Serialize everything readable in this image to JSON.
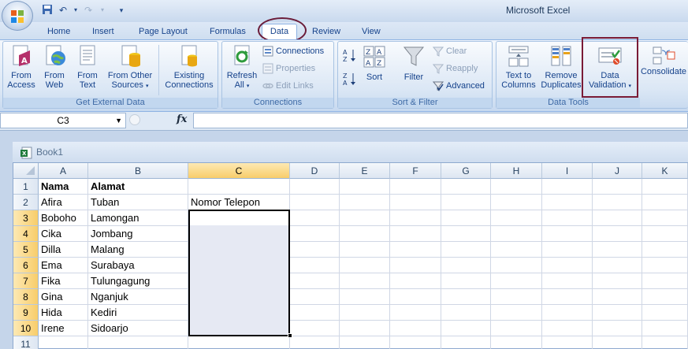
{
  "app": {
    "title": "Microsoft Excel"
  },
  "tabs": [
    {
      "label": "Home"
    },
    {
      "label": "Insert"
    },
    {
      "label": "Page Layout"
    },
    {
      "label": "Formulas"
    },
    {
      "label": "Data"
    },
    {
      "label": "Review"
    },
    {
      "label": "View"
    }
  ],
  "active_tab": "Data",
  "ribbon": {
    "get_external_data": {
      "label": "Get External Data",
      "buttons": [
        {
          "line1": "From",
          "line2": "Access",
          "icon": "access-db-icon"
        },
        {
          "line1": "From",
          "line2": "Web",
          "icon": "web-globe-icon"
        },
        {
          "line1": "From",
          "line2": "Text",
          "icon": "text-file-icon"
        },
        {
          "line1": "From Other",
          "line2": "Sources",
          "icon": "other-sources-icon"
        },
        {
          "line1": "Existing",
          "line2": "Connections",
          "icon": "existing-connections-icon"
        }
      ]
    },
    "connections": {
      "label": "Connections",
      "refresh_line1": "Refresh",
      "refresh_line2": "All",
      "connections": "Connections",
      "properties": "Properties",
      "edit_links": "Edit Links"
    },
    "sort_filter": {
      "label": "Sort & Filter",
      "sort": "Sort",
      "filter": "Filter",
      "clear": "Clear",
      "reapply": "Reapply",
      "advanced": "Advanced"
    },
    "data_tools": {
      "label": "Data Tools",
      "text_to_columns_line1": "Text to",
      "text_to_columns_line2": "Columns",
      "remove_duplicates_line1": "Remove",
      "remove_duplicates_line2": "Duplicates",
      "data_validation_line1": "Data",
      "data_validation_line2": "Validation",
      "consolidate": "Consolidate"
    }
  },
  "formula_bar": {
    "name_box": "C3",
    "fx": "fx",
    "value": ""
  },
  "workbook": {
    "title": "Book1"
  },
  "columns": [
    "A",
    "B",
    "C",
    "D",
    "E",
    "F",
    "G",
    "H",
    "I",
    "J",
    "K"
  ],
  "selected_column": "C",
  "rows": [
    {
      "n": "1",
      "a": "Nama",
      "b": "Alamat",
      "c": ""
    },
    {
      "n": "2",
      "a": "Afira",
      "b": "Tuban",
      "c": "Nomor Telepon"
    },
    {
      "n": "3",
      "a": "Boboho",
      "b": "Lamongan",
      "c": ""
    },
    {
      "n": "4",
      "a": "Cika",
      "b": "Jombang",
      "c": ""
    },
    {
      "n": "5",
      "a": "Dilla",
      "b": "Malang",
      "c": ""
    },
    {
      "n": "6",
      "a": "Ema",
      "b": "Surabaya",
      "c": ""
    },
    {
      "n": "7",
      "a": "Fika",
      "b": "Tulungagung",
      "c": ""
    },
    {
      "n": "8",
      "a": "Gina",
      "b": "Nganjuk",
      "c": ""
    },
    {
      "n": "9",
      "a": "Hida",
      "b": "Kediri",
      "c": ""
    },
    {
      "n": "10",
      "a": "Irene",
      "b": "Sidoarjo",
      "c": ""
    },
    {
      "n": "11",
      "a": "",
      "b": "",
      "c": ""
    }
  ],
  "selected_range": "C3:C10",
  "colors": {
    "highlight": "#7a1b36",
    "ribbon_text": "#15428b",
    "selection_fill": "#e6e9f3",
    "header_selected": "#f8cd6a"
  }
}
